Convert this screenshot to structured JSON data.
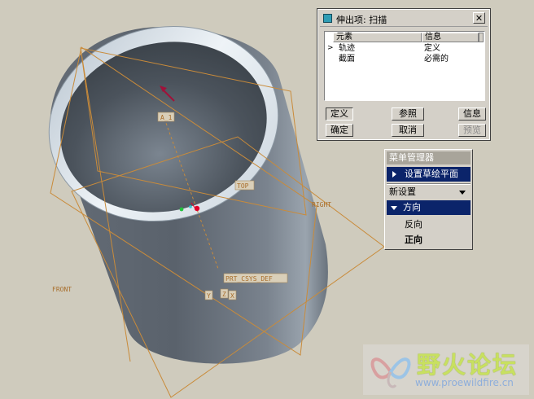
{
  "viewport": {
    "datums": {
      "a_axis": "A_1",
      "top": "TOP",
      "right": "RIGHT",
      "front": "FRONT",
      "csys": "PRT_CSYS_DEF",
      "csys_y": "Y",
      "csys_z": "Z",
      "csys_x": "X"
    },
    "colors": {
      "background": "#cfcbbd",
      "datum_plane": "#c98b3a",
      "tube_body": "#6c7580",
      "tube_rim": "#dfe7ee",
      "direction_arrow": "#a0123a"
    }
  },
  "dialog": {
    "title": "伸出项: 扫描",
    "close_label": "✕",
    "columns": [
      "元素",
      "信息"
    ],
    "rows": [
      {
        "pointer": ">",
        "element": "轨迹",
        "info": "定义"
      },
      {
        "pointer": "",
        "element": "截面",
        "info": "必需的"
      }
    ],
    "buttons": {
      "define": "定义",
      "ref": "参照",
      "info": "信息",
      "ok": "确定",
      "cancel": "取消",
      "preview": "预览"
    }
  },
  "menu": {
    "title": "菜单管理器",
    "items": {
      "sketch_plane": "设置草绘平面",
      "new_setup": "新设置",
      "direction": "方向",
      "flip": "反向",
      "okay": "正向"
    }
  },
  "watermark": {
    "title": "野火论坛",
    "url": "www.proewildfire.cn"
  }
}
